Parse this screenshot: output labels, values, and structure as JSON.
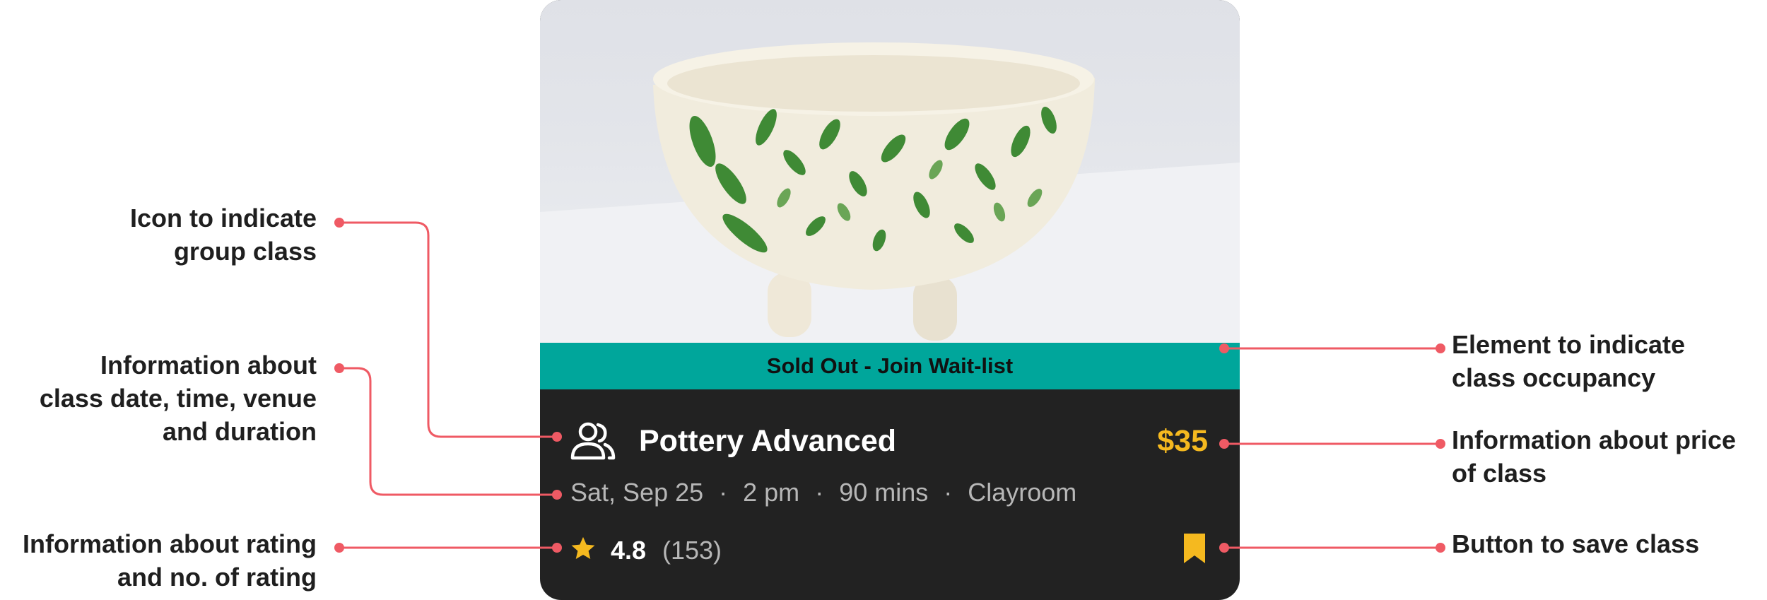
{
  "card": {
    "banner_label": "Sold Out - Join Wait-list",
    "title": "Pottery Advanced",
    "price": "$35",
    "date": "Sat, Sep 25",
    "time": "2 pm",
    "duration": "90 mins",
    "venue": "Clayroom",
    "separator": "·",
    "rating": "4.8",
    "rating_count": "(153)",
    "icons": {
      "group": "group-users-icon",
      "rating": "star-icon",
      "save": "bookmark-icon"
    },
    "colors": {
      "banner": "#00a69b",
      "card_background": "#222222",
      "price": "#f5b91f",
      "star": "#f5b91f",
      "bookmark": "#f5b91f"
    }
  },
  "annotations": {
    "group_icon": [
      "Icon to indicate",
      "group class"
    ],
    "date_time": [
      "Information about",
      "class date, time, venue",
      "and duration"
    ],
    "rating": [
      "Information about rating",
      "and no. of rating"
    ],
    "occupancy": [
      "Element to indicate",
      "class occupancy"
    ],
    "price": [
      "Information about price",
      "of class"
    ],
    "save": [
      "Button to save class"
    ],
    "line_color": "#ef5a64"
  }
}
